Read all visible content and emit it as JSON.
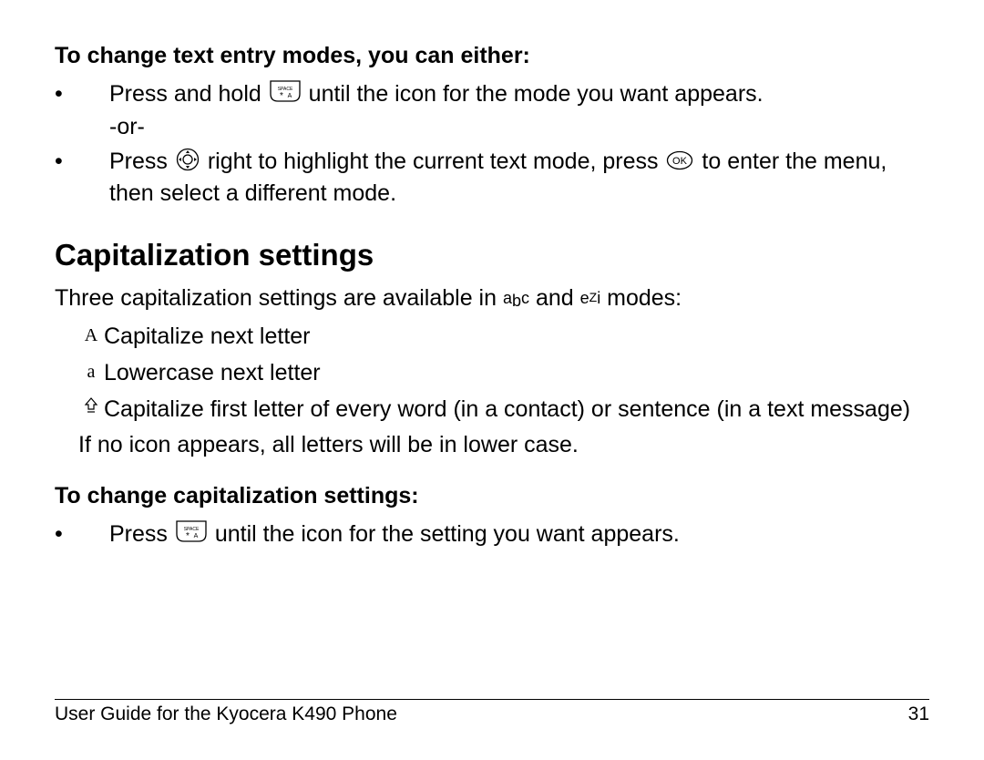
{
  "section1": {
    "heading": "To change text entry modes, you can either:",
    "item1_a": "Press and hold ",
    "item1_b": " until the icon for the mode you want appears.",
    "item1_or": "-or-",
    "item2_a": "Press ",
    "item2_b": " right to highlight the current text mode, press ",
    "item2_c": " to enter the menu, then select a different mode."
  },
  "section2": {
    "heading": "Capitalization settings",
    "intro_a": "Three capitalization settings are available in ",
    "intro_b": " and ",
    "intro_c": " modes:",
    "abc_label": "abc",
    "ezi_label": "eZi",
    "cap_items": [
      {
        "marker": "A",
        "text": "Capitalize next letter"
      },
      {
        "marker": "a",
        "text": "Lowercase next letter"
      },
      {
        "marker": "house-up-icon",
        "text": "Capitalize first letter of every word (in a contact) or sentence (in a text message)"
      }
    ],
    "note": "If no icon appears, all letters will be in lower case."
  },
  "section3": {
    "heading": "To change capitalization settings:",
    "item1_a": "Press ",
    "item1_b": " until the icon for the setting you want appears."
  },
  "footer": {
    "left": "User Guide for the Kyocera K490 Phone",
    "right": "31"
  }
}
